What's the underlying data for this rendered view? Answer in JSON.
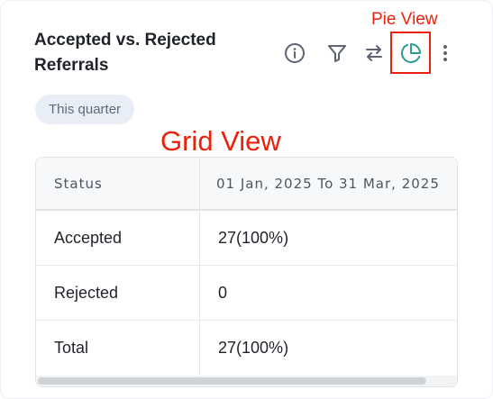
{
  "widget": {
    "title": "Accepted vs. Rejected Referrals",
    "period_chip": "This quarter",
    "toolbar": {
      "icons": [
        "info-icon",
        "filter-icon",
        "swap-icon",
        "pie-chart-icon",
        "more-vertical-icon"
      ],
      "accent_color": "#2f9a90",
      "icon_color": "#5b6470"
    }
  },
  "annotations": {
    "pie_view": "Pie View",
    "grid_view": "Grid View",
    "color": "#e8220c"
  },
  "table": {
    "headers": [
      "Status",
      "01 Jan, 2025 To 31 Mar, 2025"
    ],
    "rows": [
      {
        "status": "Accepted",
        "count": "27",
        "pct": "(100%)"
      },
      {
        "status": "Rejected",
        "count": "0",
        "pct": ""
      },
      {
        "status": "Total",
        "count": "27",
        "pct": "(100%)"
      }
    ]
  }
}
